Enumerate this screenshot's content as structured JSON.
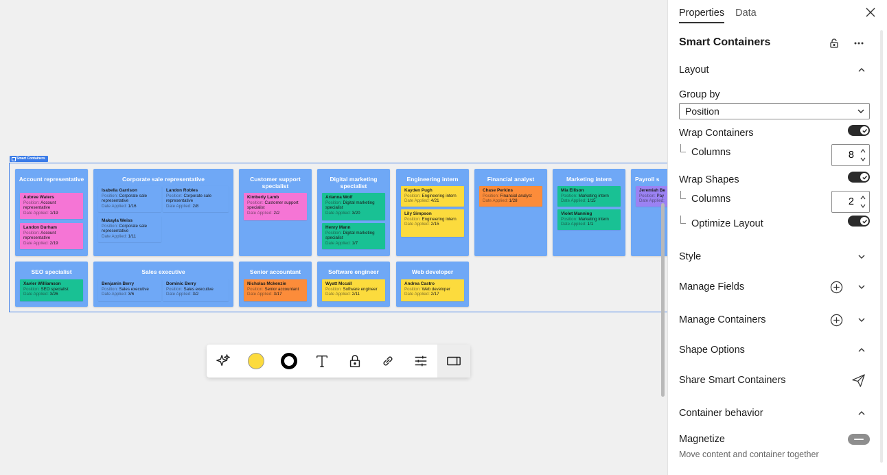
{
  "board": {
    "tag_label": "Smart Containers",
    "field_labels": {
      "position": "Position:",
      "date": "Date Applied:"
    },
    "containers": [
      {
        "title": "Account representative",
        "cards": [
          {
            "name": "Aubree Waters",
            "position": "Account representative",
            "date": "1/19",
            "color": "pink"
          },
          {
            "name": "Landon Durham",
            "position": "Account representative",
            "date": "2/19",
            "color": "pink"
          }
        ]
      },
      {
        "title": "Corporate sale representative",
        "cards": [
          {
            "name": "Isabella Garrison",
            "position": "Corporate sale representative",
            "date": "1/16",
            "color": "blue"
          },
          {
            "name": "Landon Robles",
            "position": "Corporate sale representative",
            "date": "2/8",
            "color": "blue"
          },
          {
            "name": "Makayla Weiss",
            "position": "Corporate sale representative",
            "date": "1/11",
            "color": "blue"
          }
        ]
      },
      {
        "title": "Customer support specialist",
        "cards": [
          {
            "name": "Kimberly Lamb",
            "position": "Customer support specialist",
            "date": "2/2",
            "color": "pink"
          }
        ]
      },
      {
        "title": "Digital marketing specialist",
        "cards": [
          {
            "name": "Arianna Wolf",
            "position": "Digital marketing specialist",
            "date": "3/20",
            "color": "green"
          },
          {
            "name": "Henry Mann",
            "position": "Digital marketing specialist",
            "date": "1/7",
            "color": "green"
          }
        ]
      },
      {
        "title": "Engineering intern",
        "cards": [
          {
            "name": "Kayden Pugh",
            "position": "Engineering intern",
            "date": "4/21",
            "color": "yellow"
          },
          {
            "name": "Lily Simpson",
            "position": "Engineering intern",
            "date": "2/15",
            "color": "yellow"
          }
        ]
      },
      {
        "title": "Financial analyst",
        "cards": [
          {
            "name": "Chase Perkins",
            "position": "Financial analyst",
            "date": "1/28",
            "color": "orange"
          }
        ]
      },
      {
        "title": "Marketing intern",
        "cards": [
          {
            "name": "Mia Ellison",
            "position": "Marketing intern",
            "date": "1/15",
            "color": "green"
          },
          {
            "name": "Violet Manning",
            "position": "Marketing intern",
            "date": "1/1",
            "color": "green"
          }
        ]
      },
      {
        "title": "Payroll s",
        "cards": [
          {
            "name": "Jeremiah Be",
            "position": "Pay",
            "date": "",
            "color": "purple"
          }
        ]
      },
      {
        "title": "SEO specialist",
        "cards": [
          {
            "name": "Xavier Williamson",
            "position": "SEO specialist",
            "date": "3/26",
            "color": "green"
          }
        ]
      },
      {
        "title": "Sales executive",
        "cards": [
          {
            "name": "Benjamin Berry",
            "position": "Sales executive",
            "date": "3/6",
            "color": "blue"
          },
          {
            "name": "Dominic Berry",
            "position": "Sales executive",
            "date": "3/2",
            "color": "blue"
          }
        ]
      },
      {
        "title": "Senior accountant",
        "cards": [
          {
            "name": "Nicholas Mckenzie",
            "position": "Senior accountant",
            "date": "3/17",
            "color": "orange"
          }
        ]
      },
      {
        "title": "Software engineer",
        "cards": [
          {
            "name": "Wyatt Mccall",
            "position": "Software engineer",
            "date": "2/11",
            "color": "yellow"
          }
        ]
      },
      {
        "title": "Web developer",
        "cards": [
          {
            "name": "Andrea Castro",
            "position": "Web developer",
            "date": "2/17",
            "color": "yellow"
          }
        ]
      }
    ]
  },
  "toolbar": {
    "items": [
      "sparkle-icon",
      "fill-color-swatch",
      "border-color-swatch",
      "text-icon",
      "lock-icon",
      "link-icon",
      "sliders-icon",
      "panel-icon"
    ],
    "fill_color": "#fcdb3d",
    "border_color": "#000000"
  },
  "panel": {
    "tabs": [
      "Properties",
      "Data"
    ],
    "title": "Smart Containers",
    "layout": {
      "label": "Layout",
      "group_by_label": "Group by",
      "group_by_value": "Position",
      "wrap_containers_label": "Wrap Containers",
      "wrap_containers_on": true,
      "columns_label": "Columns",
      "containers_columns": "8",
      "wrap_shapes_label": "Wrap Shapes",
      "wrap_shapes_on": true,
      "shapes_columns": "2",
      "optimize_label": "Optimize Layout",
      "optimize_on": true
    },
    "sections": {
      "style": "Style",
      "manage_fields": "Manage Fields",
      "manage_containers": "Manage Containers",
      "shape_options": "Shape Options",
      "share": "Share Smart Containers",
      "container_behavior": "Container behavior"
    },
    "magnetize": {
      "label": "Magnetize",
      "description": "Move content and container together"
    }
  }
}
